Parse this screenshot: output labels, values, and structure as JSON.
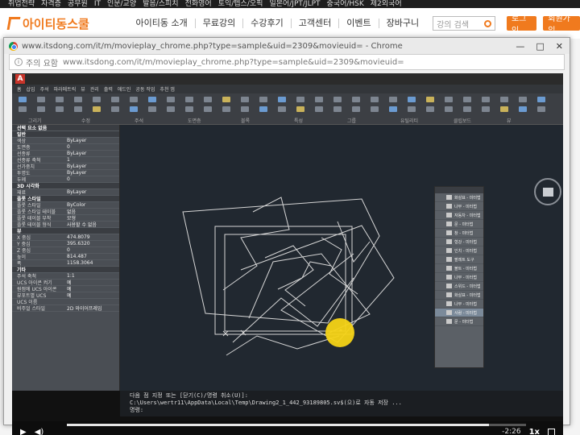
{
  "category_bar": [
    "취업전략",
    "자격증",
    "공무원",
    "IT",
    "인문/교양",
    "발음/스피치",
    "전화영어",
    "토익/텝스/오픽",
    "일본어/JPT/JLPT",
    "중국어/HSK",
    "제2외국어"
  ],
  "site": {
    "logo_text": "아이티동스쿨",
    "nav": [
      "아이티동 소개",
      "무료강의",
      "수강후기",
      "고객센터",
      "이벤트",
      "장바구니"
    ],
    "search_placeholder": "강의 검색",
    "login": "로그인",
    "join": "회원가입"
  },
  "browser": {
    "title": "www.itsdong.com/it/m/movieplay_chrome.php?type=sample&uid=2309&movieuid= - Chrome",
    "address_prefix": "주의 요함",
    "address_url": "www.itsdong.com/it/m/movieplay_chrome.php?type=sample&uid=2309&movieuid=",
    "controls": [
      "—",
      "□",
      "✕"
    ]
  },
  "autocad": {
    "app_letter": "A",
    "ribbon_tabs": [
      "홈",
      "삽입",
      "주석",
      "파라메트릭",
      "뷰",
      "관리",
      "출력",
      "애드인",
      "공동 작업",
      "추천 앱"
    ],
    "ribbon_groups": [
      "그리기",
      "수정",
      "주석",
      "도면층",
      "블록",
      "특성",
      "그룹",
      "유틸리티",
      "클립보드",
      "뷰"
    ],
    "layer_value": "ByLayer",
    "properties": [
      {
        "k": "선택 요소 없음",
        "v": "",
        "head": true
      },
      {
        "k": "일반",
        "v": "",
        "head": true
      },
      {
        "k": "색상",
        "v": "ByLayer"
      },
      {
        "k": "도면층",
        "v": "0"
      },
      {
        "k": "선종류",
        "v": "ByLayer"
      },
      {
        "k": "선종류 축척",
        "v": "1"
      },
      {
        "k": "선가중치",
        "v": "ByLayer"
      },
      {
        "k": "투명도",
        "v": "ByLayer"
      },
      {
        "k": "두께",
        "v": "0"
      },
      {
        "k": "3D 시각화",
        "v": "",
        "head": true
      },
      {
        "k": "재료",
        "v": "ByLayer"
      },
      {
        "k": "플롯 스타일",
        "v": "",
        "head": true
      },
      {
        "k": "플롯 스타일",
        "v": "ByColor"
      },
      {
        "k": "플롯 스타일 테이블",
        "v": "없음"
      },
      {
        "k": "플롯 테이블 부착",
        "v": "모형"
      },
      {
        "k": "플롯 테이블 형식",
        "v": "사용할 수 없음"
      },
      {
        "k": "뷰",
        "v": "",
        "head": true
      },
      {
        "k": "X 중심",
        "v": "474.8079"
      },
      {
        "k": "Y 중심",
        "v": "395.6320"
      },
      {
        "k": "Z 중심",
        "v": "0"
      },
      {
        "k": "높이",
        "v": "814.487"
      },
      {
        "k": "폭",
        "v": "1158.3064"
      },
      {
        "k": "기타",
        "v": "",
        "head": true
      },
      {
        "k": "주석 축척",
        "v": "1:1"
      },
      {
        "k": "UCS 아이콘 켜기",
        "v": "예"
      },
      {
        "k": "원점에 UCS 아이콘",
        "v": "예"
      },
      {
        "k": "뷰포트별 UCS",
        "v": "예"
      },
      {
        "k": "UCS 이름",
        "v": ""
      },
      {
        "k": "비주얼 스타일",
        "v": "2D 와이어프레임"
      }
    ],
    "palette_items": [
      "화살표 - 미터법",
      "나무 - 미터법",
      "자동차 - 미터법",
      "문 - 미터법",
      "창 - 미터법",
      "형강 - 미터법",
      "인치 - 미터법",
      "팔레트 도구",
      "볼트 - 미터법",
      "나무 - 미터법",
      "스위드 - 미터법",
      "화살표 - 미터법",
      "나무 - 미터법",
      "사람 - 미터법",
      "문 - 미터법"
    ],
    "command_lines": [
      "다음 점 지정 또는 [닫기(C)/명령 취소(U)]:",
      "C:\\Users\\wertr11\\AppData\\Local\\Temp\\Drawing2_1_442_93189805.sv$(으)로 자동 저장 ...",
      "명령:"
    ]
  },
  "player": {
    "time": "-2:26",
    "speed": "1x",
    "progress": 0.92
  },
  "colors": {
    "brand": "#f07a1e",
    "canvas": "#212830",
    "cursor": "#f5d316"
  }
}
